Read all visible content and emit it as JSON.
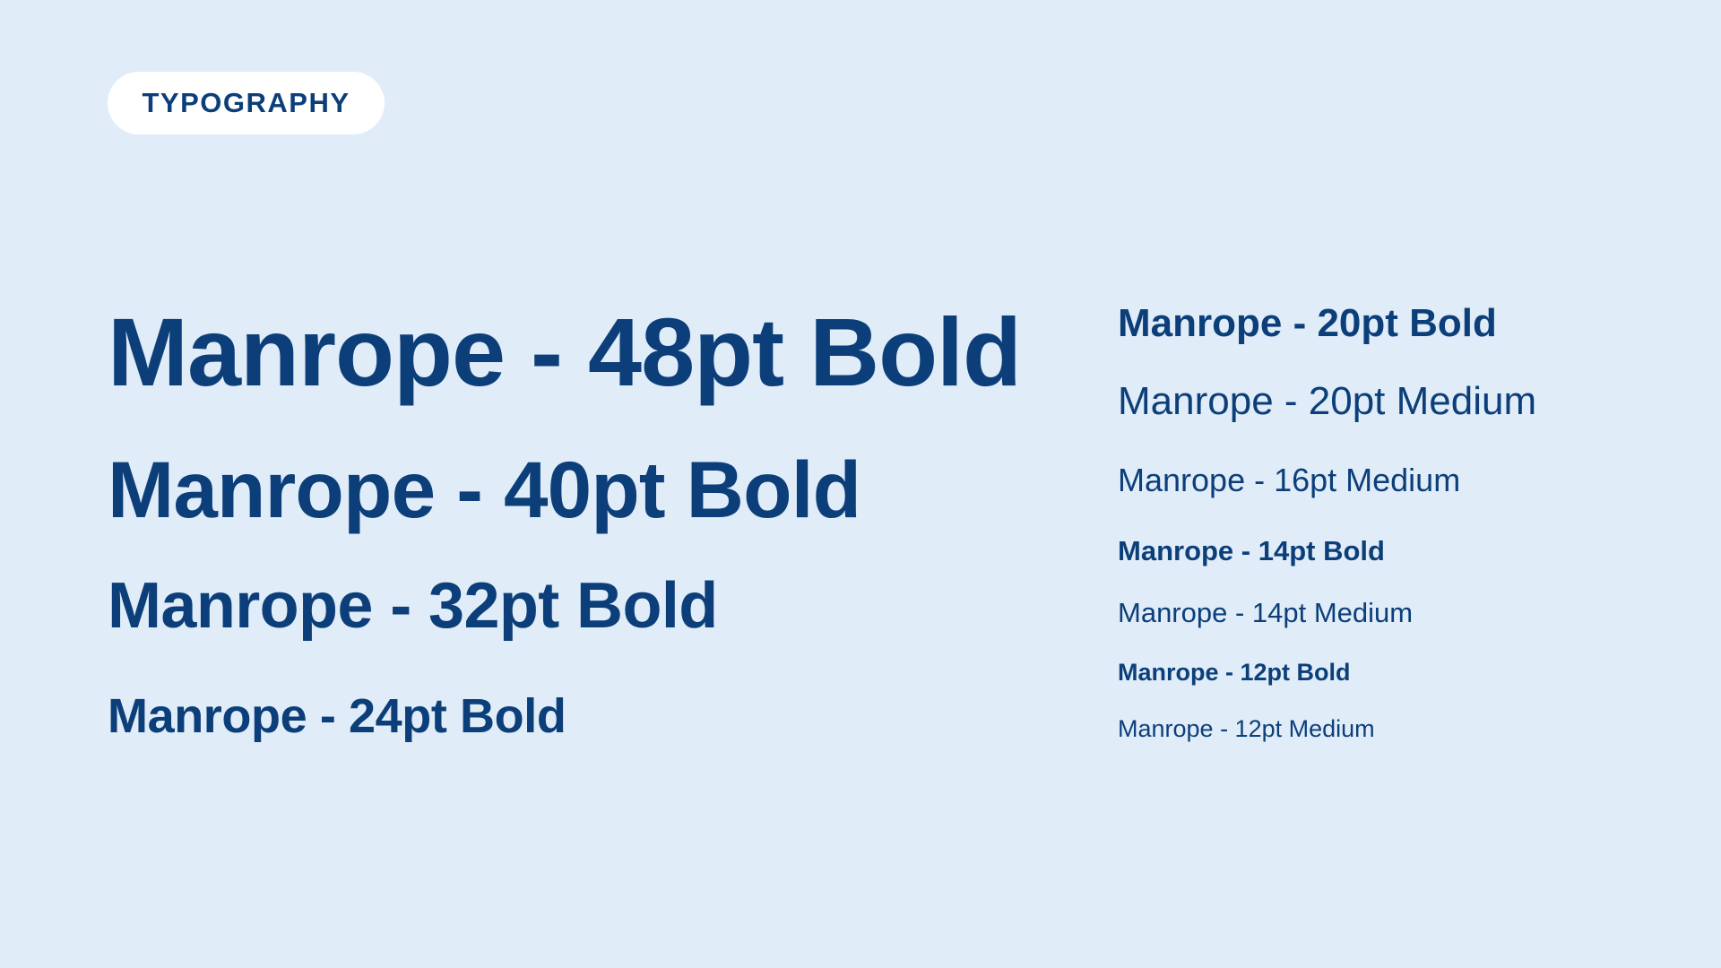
{
  "badge": {
    "label": "TYPOGRAPHY"
  },
  "samples_left": [
    "Manrope - 48pt Bold",
    "Manrope - 40pt Bold",
    "Manrope - 32pt Bold",
    "Manrope - 24pt Bold"
  ],
  "samples_right": [
    "Manrope - 20pt Bold",
    "Manrope - 20pt Medium",
    "Manrope - 16pt Medium",
    "Manrope - 14pt Bold",
    "Manrope - 14pt Medium",
    "Manrope - 12pt Bold",
    "Manrope - 12pt Medium"
  ],
  "colors": {
    "background": "#E0ECF8",
    "text": "#0C3F7A",
    "badge_background": "#FFFFFF"
  }
}
